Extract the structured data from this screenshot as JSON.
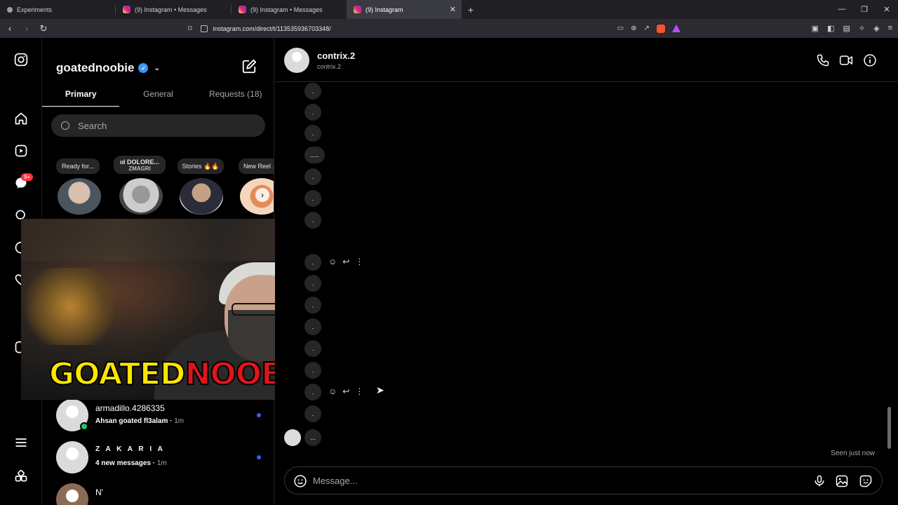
{
  "browser": {
    "tabs": [
      {
        "title": "Experiments",
        "icon_color": "#a0a0a0",
        "active": false
      },
      {
        "title": "(9) Instagram • Messages",
        "icon_color": "#e1306c",
        "active": false
      },
      {
        "title": "(9) Instagram • Messages",
        "icon_color": "#e1306c",
        "active": false
      },
      {
        "title": "(9) Instagram",
        "icon_color": "#e1306c",
        "active": true
      }
    ],
    "new_tab": "+",
    "url": "instagram.com/direct/t/113535936703348/"
  },
  "sidebar": {
    "notification_badge": "9+"
  },
  "inbox": {
    "username": "goatednoobie",
    "tabs": [
      "Primary",
      "General",
      "Requests (18)"
    ],
    "search_placeholder": "Search",
    "notes": [
      {
        "text": "Ready for..."
      },
      {
        "text": "ııl DOLORE...",
        "sub": "ZMAGRI"
      },
      {
        "text": "Stories 🔥🔥"
      },
      {
        "text": "New Reel ♪"
      }
    ],
    "conversations": [
      {
        "name": "armadillo.4286335",
        "message": "Ahsan goated fl3alam",
        "time": "1m",
        "unread": true,
        "online": true
      },
      {
        "name": "Z A K A R I A",
        "message": "4 new messages",
        "time": "1m",
        "unread": true,
        "online": false
      },
      {
        "name": "N'",
        "message": "",
        "time": "",
        "unread": false,
        "online": false
      }
    ]
  },
  "overlay": {
    "title_part1": "GOATED",
    "title_part2": "NOOBIE"
  },
  "chat": {
    "name": "contrix.2",
    "handle": "contrix.2",
    "messages": [
      ".",
      ".",
      ".",
      ".....",
      ".",
      ".",
      ".",
      ".",
      ".",
      ".",
      ".",
      ".",
      ".",
      ".",
      ".",
      "..."
    ],
    "seen": "Seen just now",
    "composer_placeholder": "Message..."
  }
}
